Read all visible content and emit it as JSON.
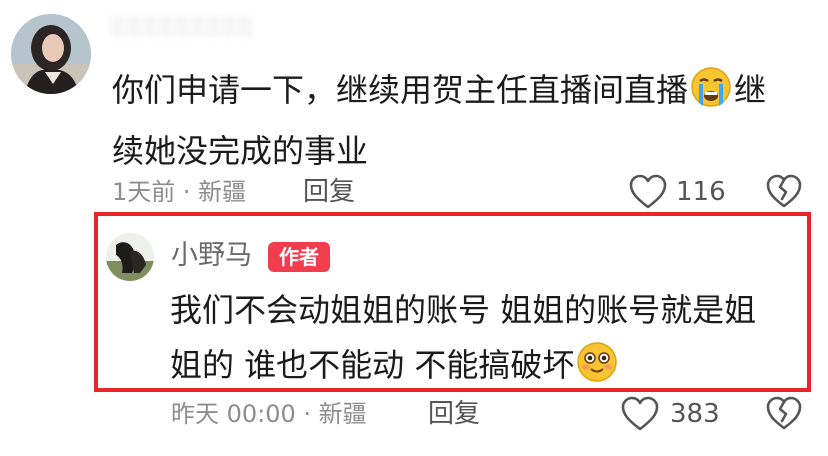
{
  "comments": [
    {
      "username": "░░░░░░░░░",
      "text_line1": "你们申请一下，继续用贺主任直播间直播",
      "emoji": "crying-face",
      "text_line2": "继",
      "text_line3": "续她没完成的事业",
      "meta": "1天前 · 新疆",
      "reply_label": "回复",
      "like_count": "116"
    },
    {
      "username": "小野马",
      "badge": "作者",
      "text_line1": "我们不会动姐姐的账号 姐姐的账号就是姐",
      "text_line2": "姐的 谁也不能动 不能搞破坏",
      "emoji": "smiling-face",
      "meta": "昨天 00:00 · 新疆",
      "reply_label": "回复",
      "like_count": "383",
      "highlight_color": "#e8262a"
    }
  ],
  "colors": {
    "text": "#1b1b1b",
    "meta": "#8d8d8d",
    "badge_bg": "#f23d4e",
    "highlight": "#e8262a"
  }
}
